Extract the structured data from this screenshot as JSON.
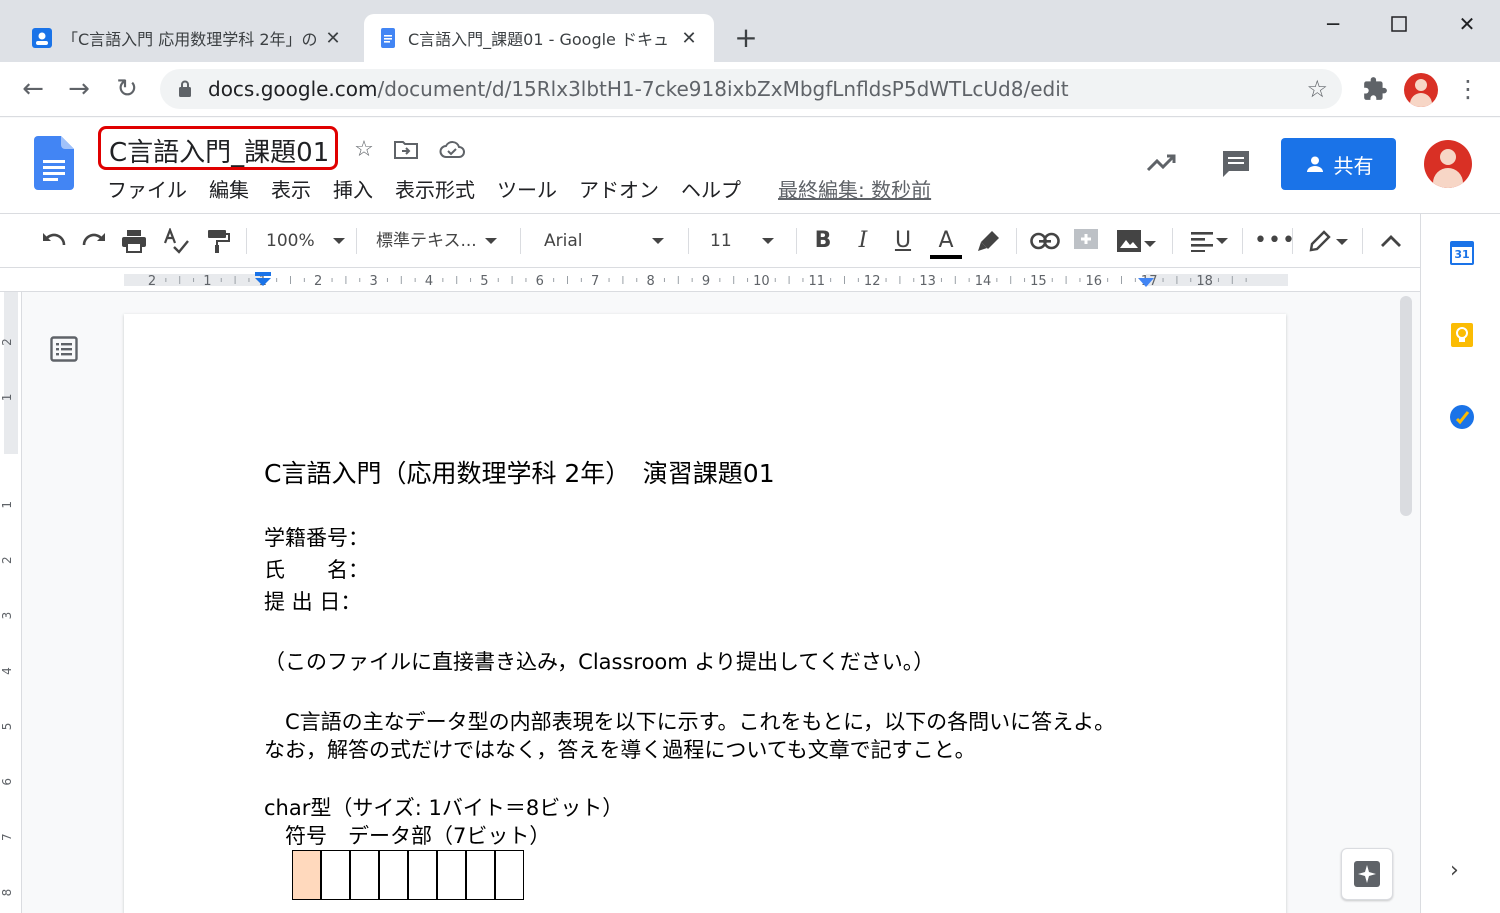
{
  "browser": {
    "tabs": [
      {
        "title": "「C言語入門 応用数理学科 2年」の",
        "favicon_color": "#1a73e8",
        "active": false
      },
      {
        "title": "C言語入門_課題01 - Google ドキュ",
        "favicon_color": "#4285f4",
        "active": true
      }
    ],
    "url_domain": "docs.google.com",
    "url_path": "/document/d/15Rlx3lbtH1-7cke918ixbZxMbgfLnfldsP5dWTLcUd8/edit"
  },
  "docs": {
    "title": "C言語入門_課題01",
    "menu": [
      "ファイル",
      "編集",
      "表示",
      "挿入",
      "表示形式",
      "ツール",
      "アドオン",
      "ヘルプ"
    ],
    "last_edit": "最終編集: 数秒前",
    "share_label": "共有",
    "accent": "#1a73e8"
  },
  "toolbar": {
    "zoom": "100%",
    "style": "標準テキス...",
    "font": "Arial",
    "font_size": "11",
    "bold": "B",
    "italic": "I",
    "underline": "U",
    "text_color": "A"
  },
  "ruler": {
    "labels": [
      "2",
      "1",
      "1",
      "2",
      "3",
      "4",
      "5",
      "6",
      "7",
      "8",
      "9",
      "10",
      "11",
      "12",
      "13",
      "14",
      "15",
      "16",
      "17",
      "18"
    ],
    "vertical_labels": [
      "2",
      "1",
      "1",
      "2",
      "3",
      "4",
      "5",
      "6",
      "7",
      "8"
    ]
  },
  "document": {
    "heading": "C言語入門（応用数理学科 2年）　演習課題01",
    "field_student_id": "学籍番号：",
    "field_name": "氏　　名：",
    "field_date": "提 出 日：",
    "note": "（このファイルに直接書き込み，Classroom より提出してください。）",
    "para1": "　C言語の主なデータ型の内部表現を以下に示す。これをもとに，以下の各問いに答えよ。",
    "para2": "なお，解答の式だけではなく，答えを導く過程についても文章で記すこと。",
    "char_type": "char型（サイズ: 1バイト＝8ビット）",
    "char_labels": "　符号　データ部（7ビット）",
    "bit_cells": 8,
    "sign_cell_color": "#ffd9bd"
  },
  "side_panel": {
    "calendar_day": "31"
  }
}
